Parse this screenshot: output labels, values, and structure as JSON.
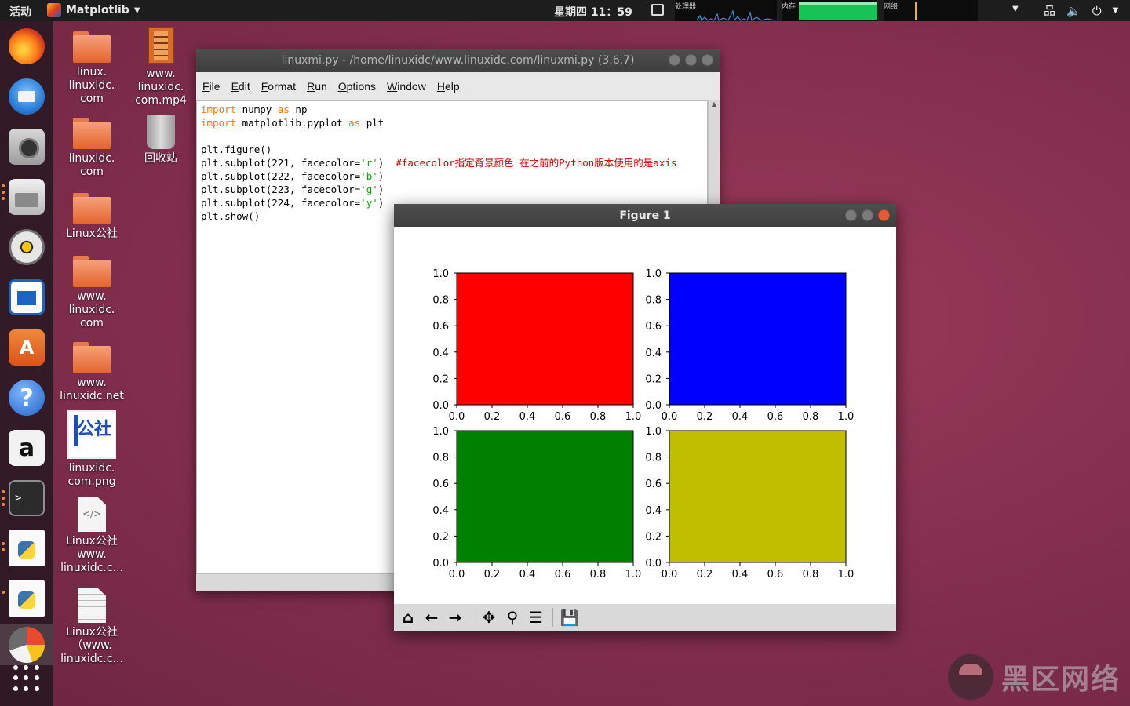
{
  "top_panel": {
    "activities": "活动",
    "app_name": "Matplotlib",
    "clock": "星期四 11：59",
    "cpu_label": "处理器",
    "mem_label": "内存",
    "net_label": "网络"
  },
  "desktop_icons": [
    {
      "label": "linux.\nlinuxidc.\ncom",
      "type": "folder"
    },
    {
      "label": "www.\nlinuxidc.\ncom.mp4",
      "type": "video"
    },
    {
      "label": "linuxidc.\ncom",
      "type": "folder"
    },
    {
      "label": "回收站",
      "type": "trash"
    },
    {
      "label": "Linux公社",
      "type": "folder"
    },
    {
      "label": "www.\nlinuxidc.\ncom",
      "type": "folder"
    },
    {
      "label": "www.\nlinuxidc.net",
      "type": "folder"
    },
    {
      "label": "linuxidc.\ncom.png",
      "type": "image"
    },
    {
      "label": "Linux公社\nwww.\nlinuxidc.c...",
      "type": "code-file"
    },
    {
      "label": "Linux公社\n（www.\nlinuxidc.c...",
      "type": "text-file"
    }
  ],
  "dock": {
    "items": [
      "firefox-icon",
      "thunderbird-icon",
      "camera-icon",
      "files-icon",
      "rhythmbox-icon",
      "writer-icon",
      "software-icon",
      "help-icon",
      "amazon-icon",
      "terminal-icon",
      "python-file-icon",
      "python-file-icon",
      "pie-app-icon",
      "show-apps-icon"
    ],
    "store_glyph": "A",
    "help_glyph": "?",
    "amazon_glyph": "a",
    "terminal_glyph": ">_"
  },
  "idle_window": {
    "title": "linuxmi.py - /home/linuxidc/www.linuxidc.com/linuxmi.py (3.6.7)",
    "menu": [
      "File",
      "Edit",
      "Format",
      "Run",
      "Options",
      "Window",
      "Help"
    ],
    "code": [
      [
        {
          "t": "import",
          "c": "kw"
        },
        {
          "t": " numpy ",
          "c": ""
        },
        {
          "t": "as",
          "c": "kw"
        },
        {
          "t": " np",
          "c": ""
        }
      ],
      [
        {
          "t": "import",
          "c": "kw"
        },
        {
          "t": " matplotlib.pyplot ",
          "c": ""
        },
        {
          "t": "as",
          "c": "kw"
        },
        {
          "t": " plt",
          "c": ""
        }
      ],
      [],
      [
        {
          "t": "plt.figure()",
          "c": ""
        }
      ],
      [
        {
          "t": "plt.subplot(221, facecolor=",
          "c": ""
        },
        {
          "t": "'r'",
          "c": "str"
        },
        {
          "t": ")  ",
          "c": ""
        },
        {
          "t": "#facecolor指定背景颜色 在之前的Python版本使用的是axis",
          "c": "cmt"
        }
      ],
      [
        {
          "t": "plt.subplot(222, facecolor=",
          "c": ""
        },
        {
          "t": "'b'",
          "c": "str"
        },
        {
          "t": ")",
          "c": ""
        }
      ],
      [
        {
          "t": "plt.subplot(223, facecolor=",
          "c": ""
        },
        {
          "t": "'g'",
          "c": "str"
        },
        {
          "t": ")",
          "c": ""
        }
      ],
      [
        {
          "t": "plt.subplot(224, facecolor=",
          "c": ""
        },
        {
          "t": "'y'",
          "c": "str"
        },
        {
          "t": ")",
          "c": ""
        }
      ],
      [
        {
          "t": "plt.show()",
          "c": ""
        }
      ]
    ]
  },
  "figure_window": {
    "title": "Figure 1",
    "toolbar": [
      {
        "name": "home-button",
        "glyph": "⌂"
      },
      {
        "name": "back-button",
        "glyph": "←"
      },
      {
        "name": "forward-button",
        "glyph": "→"
      },
      {
        "name": "pan-button",
        "glyph": "✥"
      },
      {
        "name": "zoom-button",
        "glyph": "⚲"
      },
      {
        "name": "subplots-config-button",
        "glyph": "☰"
      },
      {
        "name": "save-figure-button",
        "glyph": "💾"
      }
    ]
  },
  "chart_data": [
    {
      "type": "bar",
      "title": "",
      "facecolor": "#ff0000",
      "xlim": [
        0,
        1
      ],
      "ylim": [
        0,
        1
      ],
      "xticks": [
        "0.0",
        "0.2",
        "0.4",
        "0.6",
        "0.8",
        "1.0"
      ],
      "yticks": [
        "0.0",
        "0.2",
        "0.4",
        "0.6",
        "0.8",
        "1.0"
      ],
      "grid": false
    },
    {
      "type": "bar",
      "title": "",
      "facecolor": "#0000ff",
      "xlim": [
        0,
        1
      ],
      "ylim": [
        0,
        1
      ],
      "xticks": [
        "0.0",
        "0.2",
        "0.4",
        "0.6",
        "0.8",
        "1.0"
      ],
      "yticks": [
        "0.0",
        "0.2",
        "0.4",
        "0.6",
        "0.8",
        "1.0"
      ],
      "grid": false
    },
    {
      "type": "bar",
      "title": "",
      "facecolor": "#008000",
      "xlim": [
        0,
        1
      ],
      "ylim": [
        0,
        1
      ],
      "xticks": [
        "0.0",
        "0.2",
        "0.4",
        "0.6",
        "0.8",
        "1.0"
      ],
      "yticks": [
        "0.0",
        "0.2",
        "0.4",
        "0.6",
        "0.8",
        "1.0"
      ],
      "grid": false
    },
    {
      "type": "bar",
      "title": "",
      "facecolor": "#bfbf00",
      "xlim": [
        0,
        1
      ],
      "ylim": [
        0,
        1
      ],
      "xticks": [
        "0.0",
        "0.2",
        "0.4",
        "0.6",
        "0.8",
        "1.0"
      ],
      "yticks": [
        "0.0",
        "0.2",
        "0.4",
        "0.6",
        "0.8",
        "1.0"
      ],
      "grid": false
    }
  ],
  "watermark": {
    "text": "黑区网络"
  }
}
